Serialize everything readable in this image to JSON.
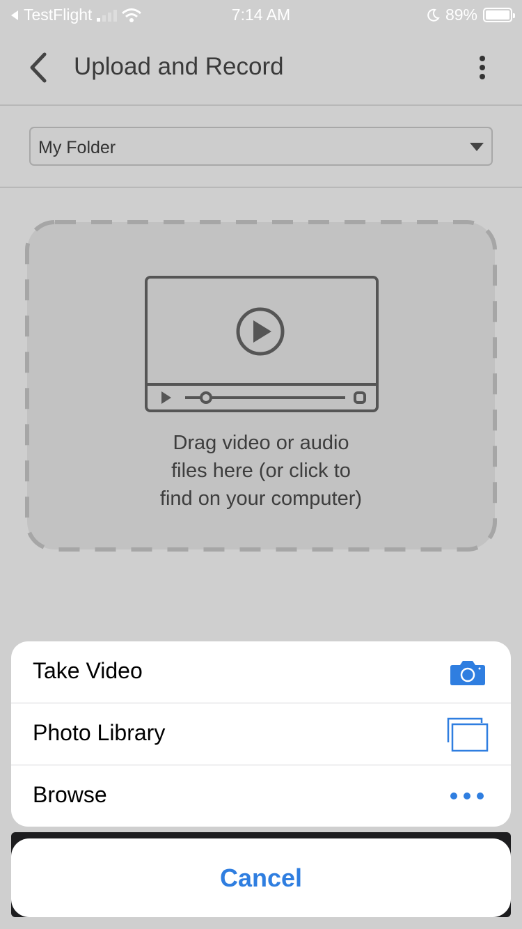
{
  "status_bar": {
    "back_app": "TestFlight",
    "time": "7:14 AM",
    "battery": "89%"
  },
  "nav": {
    "title": "Upload and Record"
  },
  "folder_select": {
    "selected": "My Folder"
  },
  "dropzone": {
    "lines": [
      "Drag video or audio",
      "files here (or click to",
      "find on your computer)"
    ]
  },
  "action_sheet": {
    "items": [
      {
        "label": "Take Video",
        "icon": "camera-icon"
      },
      {
        "label": "Photo Library",
        "icon": "photo-library-icon"
      },
      {
        "label": "Browse",
        "icon": "more-horizontal-icon"
      }
    ],
    "cancel": "Cancel"
  },
  "colors": {
    "accent": "#2f7ee0",
    "overlay_bg": "#cfcfcf",
    "sheet_bg": "#ffffff"
  }
}
